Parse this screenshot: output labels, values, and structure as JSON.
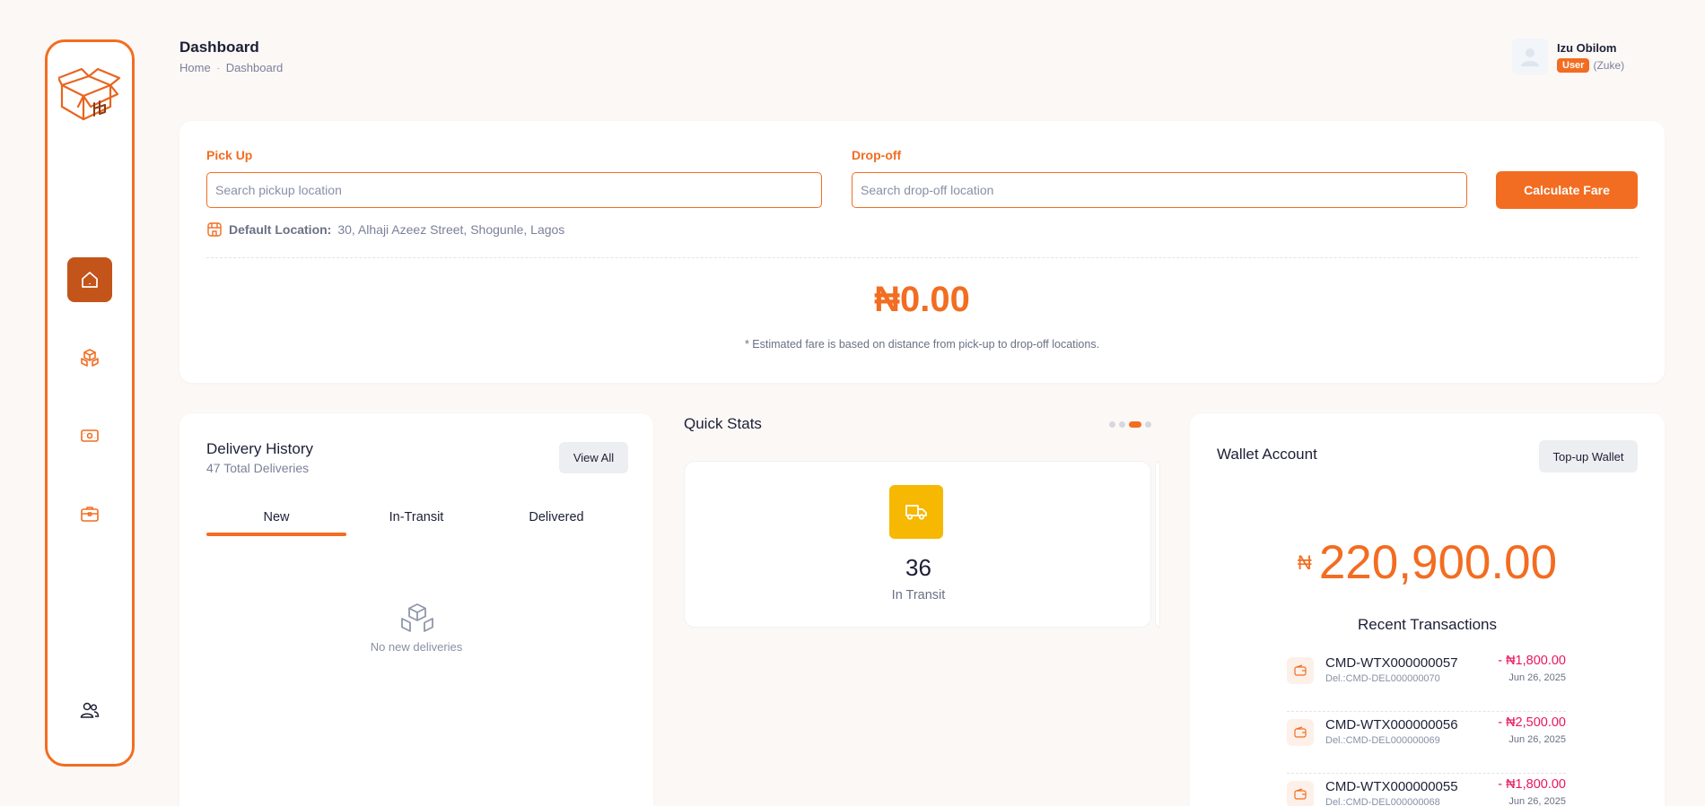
{
  "header": {
    "title": "Dashboard",
    "breadcrumb": [
      "Home",
      "Dashboard"
    ]
  },
  "user": {
    "name": "Izu Obilom",
    "role_badge": "User",
    "handle": "(Zuke)"
  },
  "sidebar": {
    "items": [
      {
        "icon": "home-icon",
        "active": true
      },
      {
        "icon": "packages-icon",
        "active": false
      },
      {
        "icon": "money-icon",
        "active": false
      },
      {
        "icon": "briefcase-icon",
        "active": false
      },
      {
        "icon": "users-icon",
        "active": false
      }
    ]
  },
  "fare": {
    "pickup_label": "Pick Up",
    "pickup_placeholder": "Search pickup location",
    "dropoff_label": "Drop-off",
    "dropoff_placeholder": "Search drop-off location",
    "calculate_label": "Calculate Fare",
    "default_location_label": "Default Location:",
    "default_location_value": "30, Alhaji Azeez Street, Shogunle, Lagos",
    "amount": "₦0.00",
    "note": "* Estimated fare is based on distance from pick-up to drop-off locations."
  },
  "delivery_history": {
    "title": "Delivery History",
    "subtitle": "47 Total Deliveries",
    "view_all_label": "View All",
    "tabs": [
      "New",
      "In-Transit",
      "Delivered"
    ],
    "active_tab": "New",
    "empty_text": "No new deliveries"
  },
  "quick_stats": {
    "title": "Quick Stats",
    "carousel_pages": 4,
    "carousel_active_index": 2,
    "card": {
      "icon": "truck-icon",
      "value": "36",
      "label": "In Transit"
    }
  },
  "wallet": {
    "title": "Wallet Account",
    "topup_label": "Top-up Wallet",
    "currency_symbol": "₦",
    "balance": "220,900.00",
    "recent_title": "Recent Transactions",
    "transactions": [
      {
        "ref": "CMD-WTX000000057",
        "del": "Del.:CMD-DEL000000070",
        "amount": "- ₦1,800.00",
        "date": "Jun 26, 2025"
      },
      {
        "ref": "CMD-WTX000000056",
        "del": "Del.:CMD-DEL000000069",
        "amount": "- ₦2,500.00",
        "date": "Jun 26, 2025"
      },
      {
        "ref": "CMD-WTX000000055",
        "del": "Del.:CMD-DEL000000068",
        "amount": "- ₦1,800.00",
        "date": "Jun 26, 2025"
      }
    ]
  },
  "colors": {
    "accent": "#f26d21",
    "active_nav": "#c3541a",
    "debit": "#e8175d",
    "stat_icon_bg": "#f6b800",
    "page_bg": "#fcf8f6"
  }
}
